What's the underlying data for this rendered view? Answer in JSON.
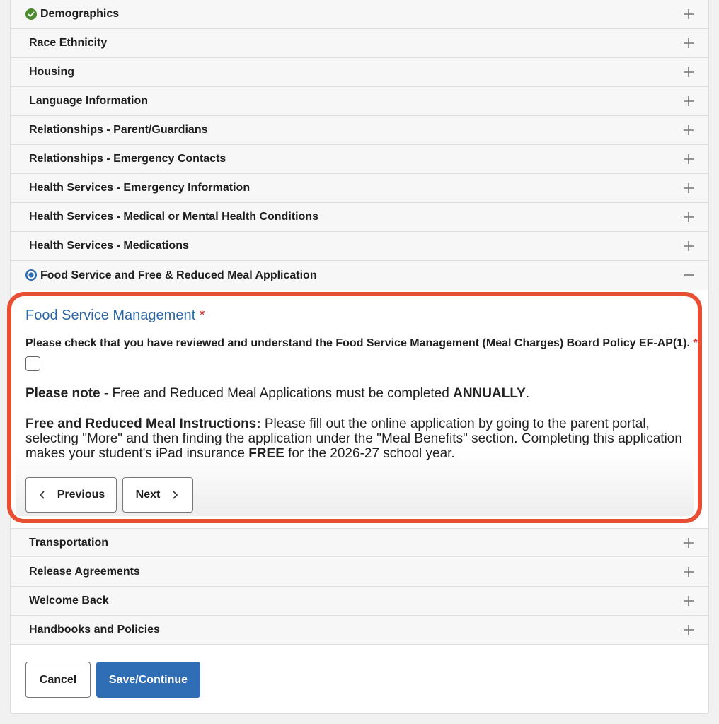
{
  "accordion_top": [
    {
      "label": "Demographics",
      "status": "complete"
    },
    {
      "label": "Race Ethnicity"
    },
    {
      "label": "Housing"
    },
    {
      "label": "Language Information"
    },
    {
      "label": "Relationships - Parent/Guardians"
    },
    {
      "label": "Relationships - Emergency Contacts"
    },
    {
      "label": "Health Services - Emergency Information"
    },
    {
      "label": "Health Services - Medical or Mental Health Conditions"
    },
    {
      "label": "Health Services - Medications"
    },
    {
      "label": "Food Service and Free & Reduced Meal Application",
      "status": "current",
      "expanded": true
    }
  ],
  "section": {
    "title": "Food Service Management",
    "required_marker": "*",
    "question": "Please check that you have reviewed and understand the Food Service Management (Meal Charges) Board Policy EF-AP(1).",
    "question_required_marker": "*",
    "checkbox_checked": false,
    "note_bold": "Please note",
    "note_text": " - Free and Reduced Meal Applications must be completed ",
    "note_emph": "ANNUALLY",
    "note_end": ".",
    "instr_bold": "Free and Reduced Meal Instructions:",
    "instr_text": " Please fill out the online application by going to the parent portal, selecting \"More\" and then finding the application under the \"Meal Benefits\" section. Completing this application makes your student's iPad insurance ",
    "instr_emph": "FREE",
    "instr_end": " for the 2026-27 school year.",
    "prev_label": "Previous",
    "next_label": "Next"
  },
  "accordion_bottom": [
    {
      "label": "Transportation"
    },
    {
      "label": "Release Agreements"
    },
    {
      "label": "Welcome Back"
    },
    {
      "label": "Handbooks and Policies"
    }
  ],
  "footer": {
    "cancel_label": "Cancel",
    "save_label": "Save/Continue"
  },
  "colors": {
    "accent": "#2f6db5",
    "highlight_frame": "#e84e31",
    "complete_green": "#4c8a2f",
    "required_red": "#d0322b"
  },
  "icons": {
    "complete": "check-circle-icon",
    "current": "radio-dot-icon",
    "collapsed": "plus-icon",
    "expanded": "minus-icon"
  }
}
